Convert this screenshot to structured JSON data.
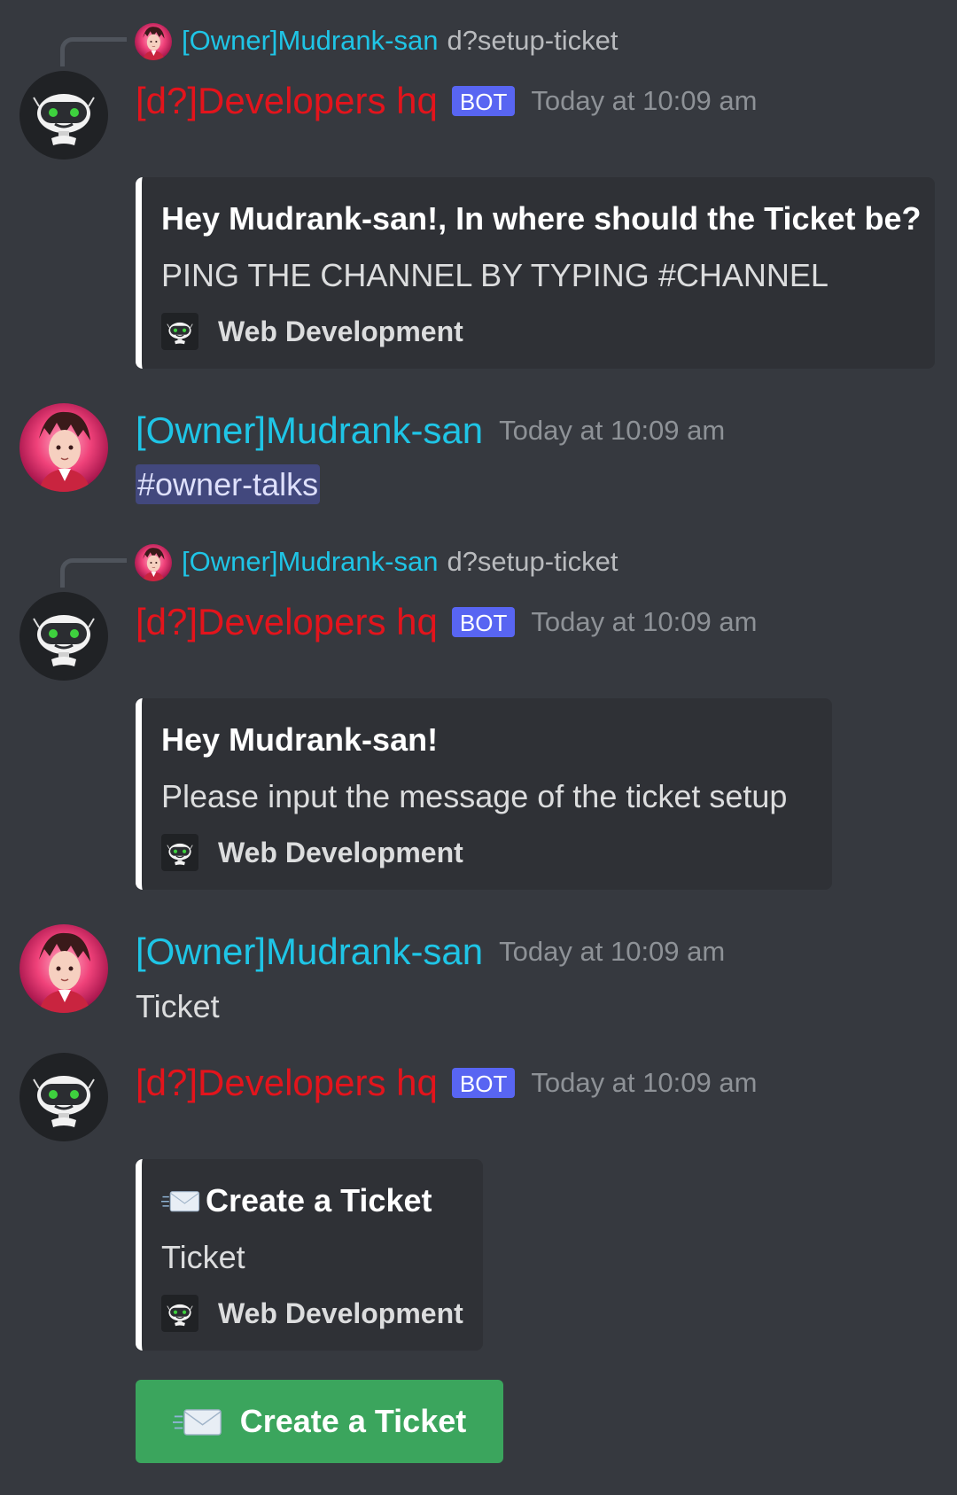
{
  "users": {
    "owner_name": "[Owner]Mudrank-san",
    "bot_name": "[d?]Developers hq",
    "bot_tag": "BOT"
  },
  "messages": [
    {
      "reply": {
        "name": "[Owner]Mudrank-san",
        "command": "d?setup-ticket"
      },
      "timestamp": "Today at 10:09 am",
      "embed": {
        "title": "Hey Mudrank-san!, In where should the Ticket be?",
        "description": "PING THE CHANNEL BY TYPING #CHANNEL",
        "footer": "Web Development"
      }
    },
    {
      "timestamp": "Today at 10:09 am",
      "text": "#owner-talks"
    },
    {
      "reply": {
        "name": "[Owner]Mudrank-san",
        "command": "d?setup-ticket"
      },
      "timestamp": "Today at 10:09 am",
      "embed": {
        "title": "Hey Mudrank-san!",
        "description": "Please input the message of the ticket setup",
        "footer": "Web Development"
      }
    },
    {
      "timestamp": "Today at 10:09 am",
      "text": "Ticket"
    },
    {
      "timestamp": "Today at 10:09 am",
      "embed": {
        "title": "Create a Ticket",
        "description": "Ticket",
        "footer": "Web Development"
      },
      "button": {
        "label": "Create a Ticket",
        "color": "#3ba55d",
        "icon": "envelope-icon"
      }
    }
  ],
  "colors": {
    "background": "#36393f",
    "embed_background": "#2f3136",
    "owner_name": "#1fc5e6",
    "bot_name": "#e3141c",
    "bot_tag": "#5865f2",
    "mention_bg": "#5865f2"
  }
}
